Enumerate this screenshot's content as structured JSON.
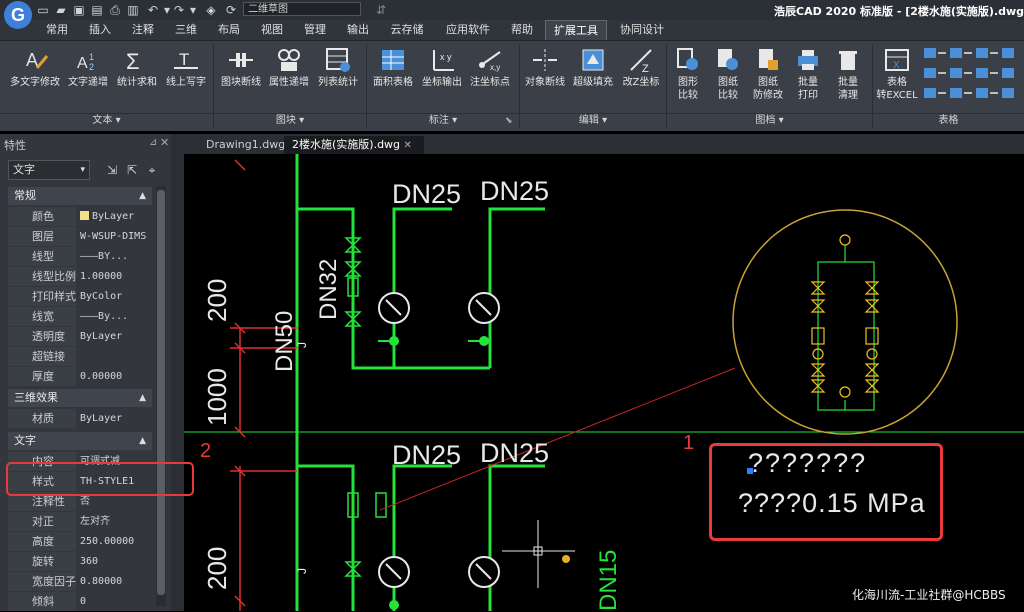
{
  "titlebar": {
    "workspace": "二维草图",
    "title": "浩辰CAD 2020 标准版 - [2楼水施(实施版).dwg]"
  },
  "menus": [
    "常用",
    "插入",
    "注释",
    "三维",
    "布局",
    "视图",
    "管理",
    "输出",
    "云存储",
    "应用软件",
    "帮助",
    "扩展工具",
    "协同设计"
  ],
  "ribbon": {
    "buttons": [
      {
        "label": "多文字修改"
      },
      {
        "label": "文字递增"
      },
      {
        "label": "统计求和"
      },
      {
        "label": "线上写字"
      },
      {
        "label": "图块断线"
      },
      {
        "label": "属性递增"
      },
      {
        "label": "列表统计"
      },
      {
        "label": "面积表格"
      },
      {
        "label": "坐标输出"
      },
      {
        "label": "注坐标点"
      },
      {
        "label": "对象断线"
      },
      {
        "label": "超级填充"
      },
      {
        "label": "改Z坐标"
      },
      {
        "label": "图形\n比较"
      },
      {
        "label": "图纸\n比较"
      },
      {
        "label": "图纸\n防修改"
      },
      {
        "label": "批量\n打印"
      },
      {
        "label": "批量\n清理"
      },
      {
        "label": "表格\n转EXCEL"
      }
    ],
    "groups": [
      "文本 ▾",
      "图块 ▾",
      "标注 ▾",
      "编辑 ▾",
      "图档 ▾",
      "表格"
    ]
  },
  "properties": {
    "title": "特性",
    "selection": "文字",
    "sections": {
      "general": "常规",
      "threed": "三维效果",
      "text": "文字"
    },
    "general_rows": [
      {
        "k": "颜色",
        "v": "ByLayer"
      },
      {
        "k": "图层",
        "v": "W-WSUP-DIMS"
      },
      {
        "k": "线型",
        "v": "———BY..."
      },
      {
        "k": "线型比例",
        "v": "1.00000"
      },
      {
        "k": "打印样式",
        "v": "ByColor"
      },
      {
        "k": "线宽",
        "v": "———By..."
      },
      {
        "k": "透明度",
        "v": "ByLayer"
      },
      {
        "k": "超链接",
        "v": ""
      },
      {
        "k": "厚度",
        "v": "0.00000"
      }
    ],
    "threed_rows": [
      {
        "k": "材质",
        "v": "ByLayer"
      }
    ],
    "text_rows": [
      {
        "k": "内容",
        "v": "可调式减..."
      },
      {
        "k": "样式",
        "v": "TH-STYLE1"
      },
      {
        "k": "注释性",
        "v": "否"
      },
      {
        "k": "对正",
        "v": "左对齐"
      },
      {
        "k": "高度",
        "v": "250.00000"
      },
      {
        "k": "旋转",
        "v": "360"
      },
      {
        "k": "宽度因子",
        "v": "0.80000"
      },
      {
        "k": "倾斜",
        "v": "0"
      }
    ]
  },
  "tabs": [
    "Drawing1.dwg",
    "2楼水施(实施版).dwg"
  ],
  "drawing": {
    "dn25_a": "DN25",
    "dn25_b": "DN25",
    "dn25_c": "DN25",
    "dn25_d": "DN25",
    "dn32": "DN32",
    "dn50": "DN50",
    "dn15": "DN15",
    "dim_200_top": "200",
    "dim_1000": "1000",
    "dim_200_bottom": "200",
    "j_mark": "J",
    "garbled_line1": "???????",
    "garbled_line2": "????0.15 MPa"
  },
  "annotations": {
    "label1": "1",
    "label2": "2"
  },
  "watermark": "化海川流-工业社群@HCBBS",
  "colors": {
    "pipe": "#23e23a",
    "text": "#e8e8e8",
    "dimension": "#e03030",
    "highlight": "#e83a3a",
    "detail_circle": "#c8a238",
    "detail_content": "#f0c020"
  }
}
